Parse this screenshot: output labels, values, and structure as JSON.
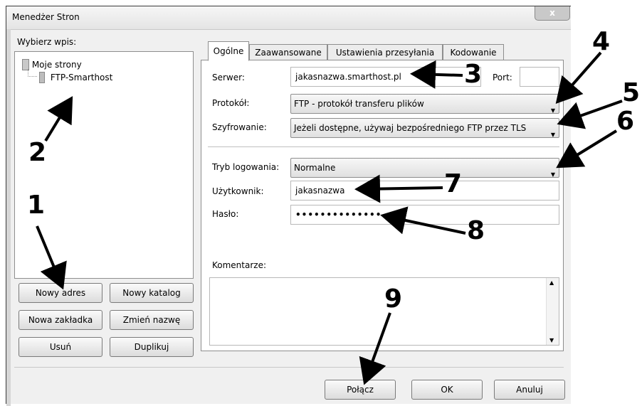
{
  "window": {
    "title": "Menedżer Stron",
    "close": "x"
  },
  "left": {
    "select_label": "Wybierz wpis:",
    "tree": {
      "root": "Moje strony",
      "child": "FTP-Smarthost"
    },
    "buttons": {
      "new_address": "Nowy adres",
      "new_folder": "Nowy katalog",
      "new_bookmark": "Nowa zakładka",
      "rename": "Zmień nazwę",
      "delete": "Usuń",
      "duplicate": "Duplikuj"
    }
  },
  "tabs": [
    "Ogólne",
    "Zaawansowane",
    "Ustawienia przesyłania",
    "Kodowanie"
  ],
  "form": {
    "server_label": "Serwer:",
    "server_value": "jakasnazwa.smarthost.pl",
    "port_label": "Port:",
    "port_value": "",
    "protocol_label": "Protokół:",
    "protocol_value": "FTP - protokół transferu plików",
    "encryption_label": "Szyfrowanie:",
    "encryption_value": "Jeżeli dostępne, używaj bezpośredniego FTP przez TLS",
    "logon_label": "Tryb logowania:",
    "logon_value": "Normalne",
    "user_label": "Użytkownik:",
    "user_value": "jakasnazwa",
    "password_label": "Hasło:",
    "password_value": "••••••••••••••",
    "comments_label": "Komentarze:"
  },
  "footer": {
    "connect": "Połącz",
    "ok": "OK",
    "cancel": "Anuluj"
  },
  "callouts": [
    "1",
    "2",
    "3",
    "4",
    "5",
    "6",
    "7",
    "8",
    "9"
  ],
  "icons": {
    "scroll_up": "up-arrow-icon",
    "scroll_down": "down-arrow-icon",
    "combo": "chevron-down-icon"
  }
}
